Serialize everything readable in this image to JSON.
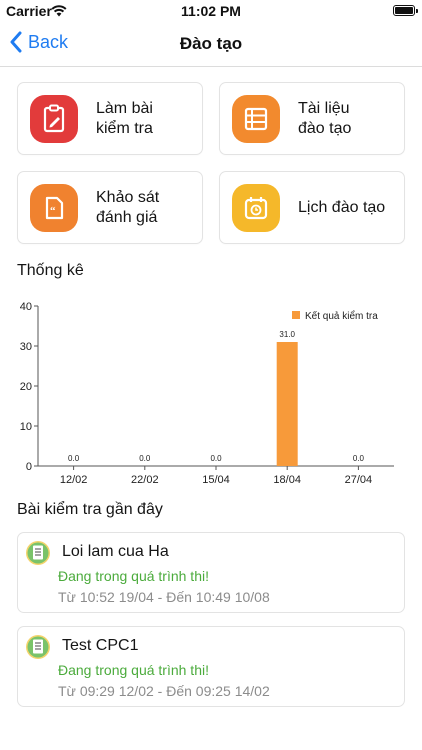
{
  "status_bar": {
    "carrier": "Carrier",
    "time": "11:02 PM"
  },
  "nav": {
    "back_label": "Back",
    "title": "Đào tạo"
  },
  "menu": [
    {
      "line1": "Làm bài",
      "line2": "kiểm tra",
      "icon": "clipboard-edit-icon",
      "color": "#e23b3b"
    },
    {
      "line1": "Tài liệu",
      "line2": "đào tạo",
      "icon": "document-list-icon",
      "color": "#f28a2e"
    },
    {
      "line1": "Khảo sát",
      "line2": "đánh giá",
      "icon": "quote-survey-icon",
      "color": "#f0822f"
    },
    {
      "line1": "Lịch đào tạo",
      "line2": "",
      "icon": "calendar-clock-icon",
      "color": "#f5b82a"
    }
  ],
  "stats": {
    "title": "Thống kê"
  },
  "chart_data": {
    "type": "bar",
    "categories": [
      "12/02",
      "22/02",
      "15/04",
      "18/04",
      "27/04"
    ],
    "series": [
      {
        "name": "Kết quả kiểm tra",
        "values": [
          0.0,
          0.0,
          0.0,
          31.0,
          0.0
        ],
        "color": "#f79a3a"
      }
    ],
    "value_labels": [
      "0.0",
      "0.0",
      "0.0",
      "31.0",
      "0.0"
    ],
    "yticks": [
      "0",
      "10",
      "20",
      "30",
      "40"
    ],
    "ylim": [
      0,
      40
    ],
    "grid": false,
    "legend_position": "top-right"
  },
  "recent": {
    "title": "Bài kiểm tra gần đây",
    "items": [
      {
        "name": "Loi lam cua Ha",
        "status": "Đang trong quá trình thi!",
        "time": "Từ 10:52 19/04 - Đến 10:49 10/08"
      },
      {
        "name": "Test CPC1",
        "status": "Đang trong quá trình thi!",
        "time": "Từ 09:29 12/02 - Đến 09:25 14/02"
      }
    ]
  }
}
